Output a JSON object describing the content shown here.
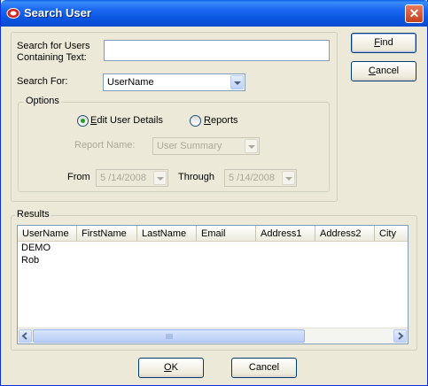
{
  "window": {
    "title": "Search User",
    "close_glyph": "✕"
  },
  "search": {
    "label_line1": "Search for Users",
    "label_line2": "Containing Text:",
    "value": "",
    "search_for_label": "Search For:",
    "search_for_value": "UserName"
  },
  "options": {
    "group_label": "Options",
    "radio_edit": {
      "label": "Edit User Details",
      "selected": true
    },
    "radio_reports": {
      "label": "Reports",
      "selected": false
    },
    "report_name_label": "Report Name:",
    "report_name_value": "User Summary",
    "from_label": "From",
    "from_value": "5 /14/2008",
    "through_label": "Through",
    "through_value": "5 /14/2008"
  },
  "buttons": {
    "find": "Find",
    "cancel_top": "Cancel",
    "ok": "OK",
    "cancel_bottom": "Cancel"
  },
  "results": {
    "group_label": "Results",
    "columns": [
      "UserName",
      "FirstName",
      "LastName",
      "Email",
      "Address1",
      "Address2",
      "City"
    ],
    "rows": [
      "DEMO",
      "Rob"
    ]
  },
  "icons": {
    "title": "app-logo-icon",
    "close": "close-icon"
  },
  "colors": {
    "titlebar": "#0a55df",
    "dialog_bg": "#ece9d8",
    "close_button": "#c4401c"
  }
}
